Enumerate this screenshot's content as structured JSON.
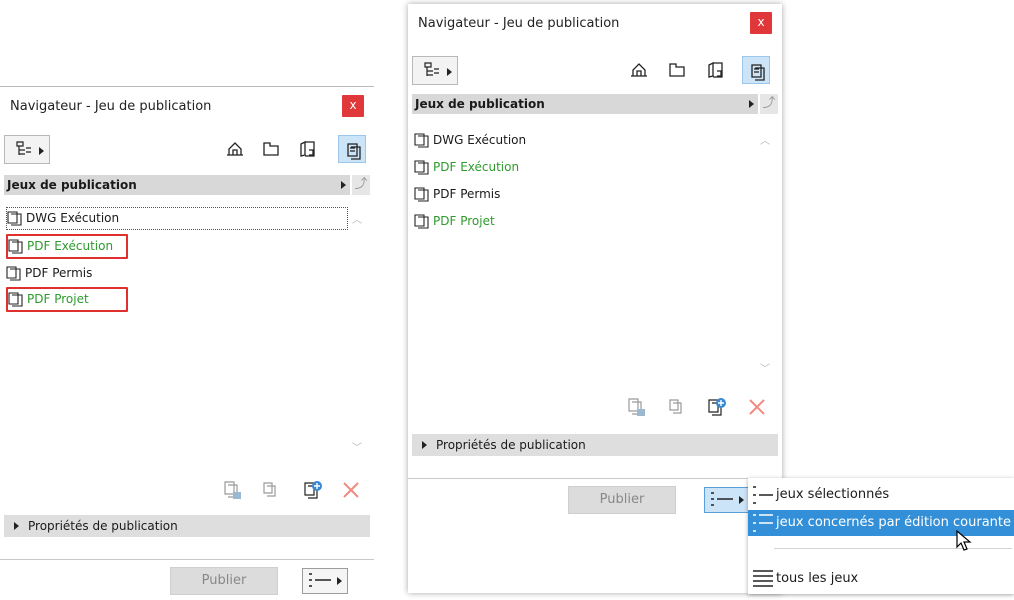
{
  "panels": [
    {
      "title": "Navigateur - Jeu de publication",
      "close": "x",
      "header": "Jeux de publication",
      "items": [
        {
          "label": "DWG Exécution",
          "color": "#1a1a1a"
        },
        {
          "label": "PDF Exécution",
          "color": "#2e9a2e"
        },
        {
          "label": "PDF Permis",
          "color": "#1a1a1a"
        },
        {
          "label": "PDF Projet",
          "color": "#2e9a2e"
        }
      ],
      "properties": "Propriétés de publication",
      "publish": "Publier"
    },
    {
      "title": "Navigateur - Jeu de publication",
      "close": "x",
      "header": "Jeux de publication",
      "items": [
        {
          "label": "DWG Exécution",
          "color": "#1a1a1a"
        },
        {
          "label": "PDF Exécution",
          "color": "#2e9a2e"
        },
        {
          "label": "PDF Permis",
          "color": "#1a1a1a"
        },
        {
          "label": "PDF Projet",
          "color": "#2e9a2e"
        }
      ],
      "properties": "Propriétés de publication",
      "publish": "Publier"
    }
  ],
  "publish_menu": {
    "items": [
      "jeux sélectionnés",
      "jeux concernés par édition courante",
      "tous les jeux"
    ]
  },
  "colors": {
    "accent": "#3390d8",
    "close": "#e0373a",
    "green": "#2e9a2e",
    "highlight_box": "#e0302d"
  },
  "icons": [
    "project-map-icon",
    "view-map-icon",
    "layout-book-icon",
    "publisher-sets-icon",
    "new-subset-icon",
    "clone-icon",
    "new-set-icon",
    "delete-icon",
    "publish-options-icon"
  ]
}
